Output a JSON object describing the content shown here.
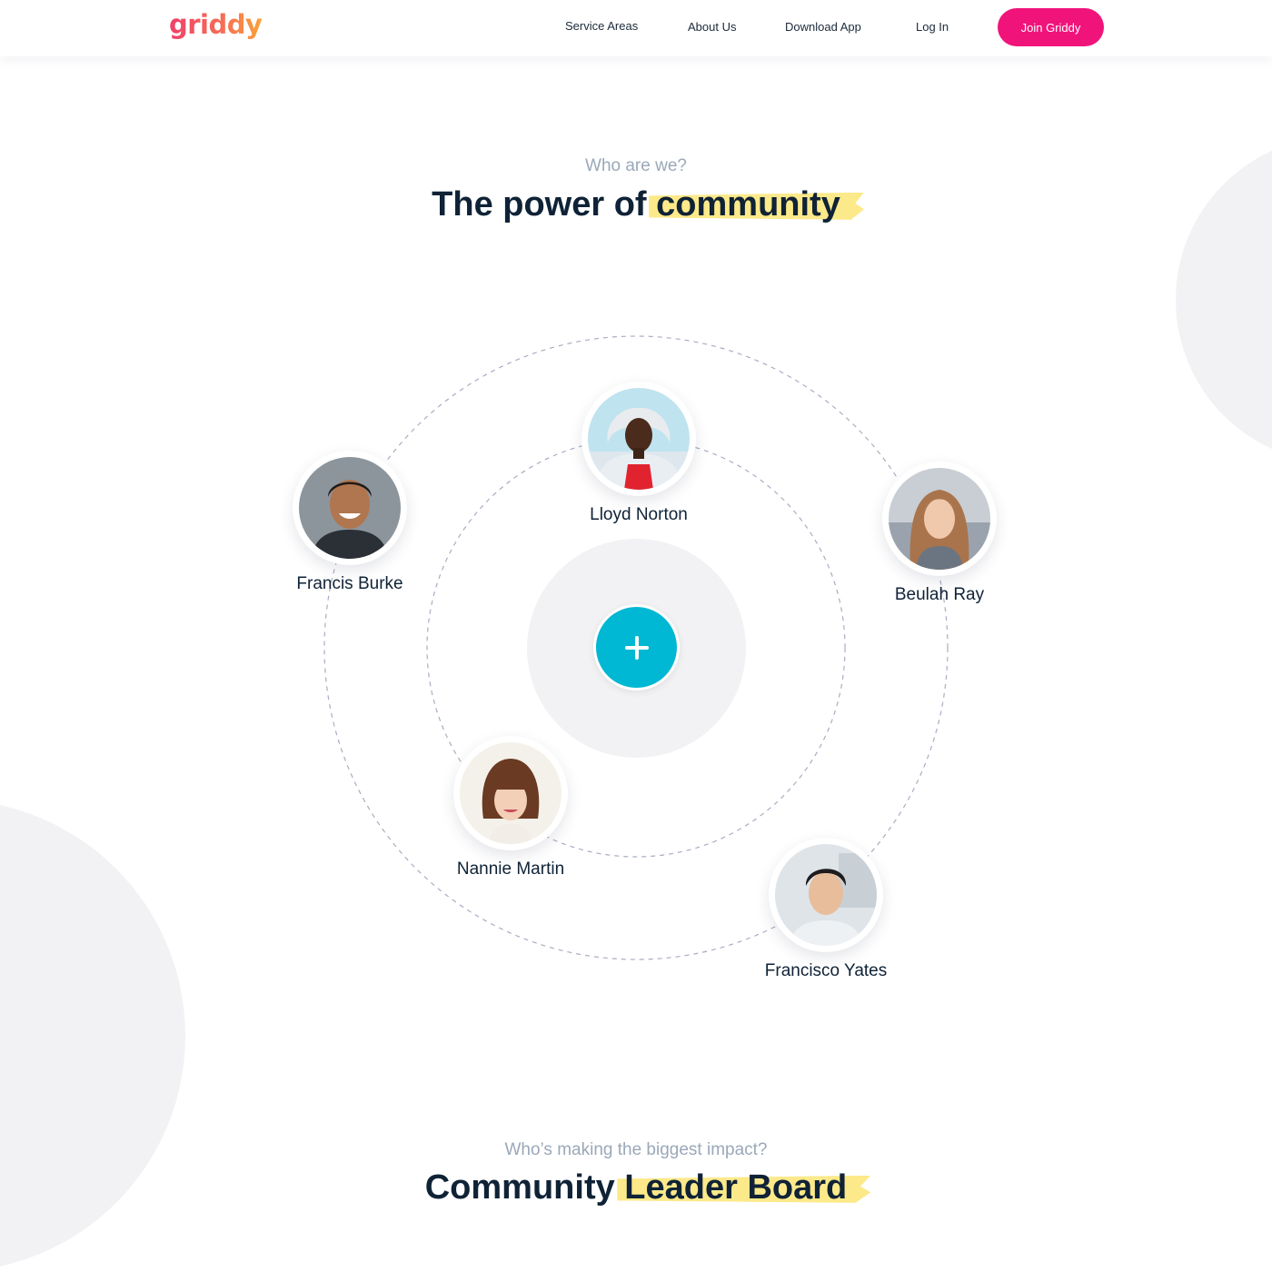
{
  "header": {
    "logo": "griddy",
    "nav": [
      "Service Areas",
      "About Us",
      "Download App",
      "Log In"
    ],
    "cta": "Join Griddy"
  },
  "section1": {
    "eyebrow": "Who are we?",
    "title_prefix": "The power of",
    "title_highlight": "community"
  },
  "orbit": {
    "center_icon": "plus-icon",
    "members": [
      {
        "name": "Lloyd Norton",
        "icon": "avatar-lloyd-norton"
      },
      {
        "name": "Francis Burke",
        "icon": "avatar-francis-burke"
      },
      {
        "name": "Beulah Ray",
        "icon": "avatar-beulah-ray"
      },
      {
        "name": "Nannie Martin",
        "icon": "avatar-nannie-martin"
      },
      {
        "name": "Francisco Yates",
        "icon": "avatar-francisco-yates"
      }
    ]
  },
  "section2": {
    "eyebrow": "Who’s making the biggest impact?",
    "title_prefix": "Community",
    "title_highlight": "Leader Board"
  },
  "colors": {
    "brand_pink": "#f0147a",
    "accent_cyan": "#00b8d4",
    "highlight_yellow": "#fce98a",
    "heading": "#0f2236",
    "muted": "#9aa8b8",
    "soft_gray": "#f2f2f4"
  }
}
